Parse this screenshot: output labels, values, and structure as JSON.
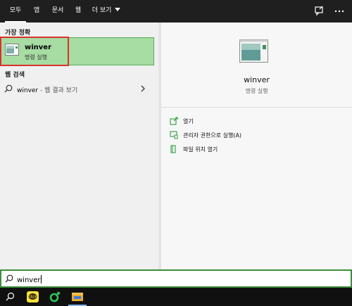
{
  "filter_tabs": [
    {
      "label": "모두"
    },
    {
      "label": "앱"
    },
    {
      "label": "문서"
    },
    {
      "label": "웹"
    },
    {
      "label": "더 보기"
    }
  ],
  "top_icons": [
    "feedback-icon",
    "more-icon"
  ],
  "best_match": {
    "section_title": "가장 정확",
    "name": "winver",
    "type": "명령 실행"
  },
  "web_search": {
    "section_title": "웹 검색",
    "query": "winver",
    "suffix": " - 웹 결과 보기"
  },
  "detail": {
    "name": "winver",
    "type": "명령 실행",
    "actions": [
      {
        "label": "열기",
        "icon": "open-icon"
      },
      {
        "label": "관리자 권한으로 실행(A)",
        "icon": "run-as-admin-icon"
      },
      {
        "label": "파일 위치 열기",
        "icon": "file-location-icon"
      }
    ]
  },
  "search": {
    "value": "winver"
  },
  "taskbar_icons": [
    "search-icon",
    "kakaotalk-icon",
    "green-app-icon",
    "file-explorer-icon"
  ],
  "colors": {
    "accent_green": "#a7dca3",
    "selection_border": "#d8332b",
    "icon_green": "#2e9e3e"
  }
}
